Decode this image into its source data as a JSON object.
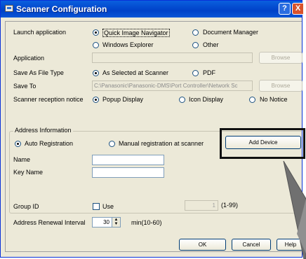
{
  "window": {
    "title": "Scanner Configuration",
    "help_glyph": "?",
    "close_glyph": "X"
  },
  "launch": {
    "label": "Launch application",
    "opt_quick": "Quick Image Navigator",
    "opt_docmgr": "Document Manager",
    "opt_explorer": "Windows Explorer",
    "opt_other": "Other",
    "selected": "Quick Image Navigator"
  },
  "application": {
    "label": "Application",
    "value": "",
    "browse": "Browse"
  },
  "save_as": {
    "label": "Save As File Type",
    "opt_scanner": "As Selected at Scanner",
    "opt_pdf": "PDF",
    "selected": "As Selected at Scanner"
  },
  "save_to": {
    "label": "Save To",
    "value": "C:\\Panasonic\\Panasonic-DMS\\Port Controller\\Network Sc",
    "browse": "Browse"
  },
  "reception": {
    "label": "Scanner reception notice",
    "opt_popup": "Popup Display",
    "opt_icon": "Icon Display",
    "opt_none": "No Notice",
    "selected": "Popup Display"
  },
  "address": {
    "legend": "Address Information",
    "opt_auto": "Auto Registration",
    "opt_manual": "Manual registration at scanner",
    "selected": "Auto Registration",
    "add_device": "Add Device",
    "name_label": "Name",
    "name_value": "",
    "keyname_label": "Key Name",
    "keyname_value": "",
    "group_label": "Group ID",
    "use_label": "Use",
    "group_value": "1",
    "group_range": "(1-99)",
    "renewal_label": "Address Renewal Interval",
    "renewal_value": "30",
    "renewal_range": "min(10-60)"
  },
  "buttons": {
    "ok": "OK",
    "cancel": "Cancel",
    "help": "Help"
  },
  "colors": {
    "title_bar": "#0041c8",
    "window_bg": "#ece9d8",
    "callout": "#111111"
  }
}
